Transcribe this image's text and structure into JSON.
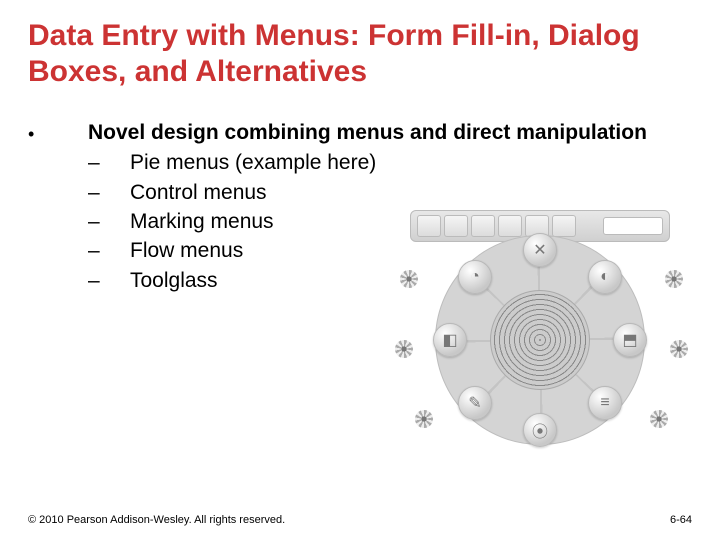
{
  "title": "Data Entry with Menus: Form Fill-in, Dialog Boxes, and Alternatives",
  "bullet": {
    "mark": "•",
    "text": "Novel design combining menus and direct manipulation"
  },
  "subitems": [
    {
      "dash": "–",
      "text": "Pie menus (example here)"
    },
    {
      "dash": "–",
      "text": "Control menus"
    },
    {
      "dash": "–",
      "text": "Marking menus"
    },
    {
      "dash": "–",
      "text": "Flow menus"
    },
    {
      "dash": "–",
      "text": "Toolglass"
    }
  ],
  "pie_glyphs": [
    "✕",
    "◐",
    "⬒",
    "≡",
    "⦿",
    "✎",
    "◧",
    "◔"
  ],
  "footer": {
    "copyright": "© 2010 Pearson Addison-Wesley. All rights reserved.",
    "page": "6-64"
  }
}
